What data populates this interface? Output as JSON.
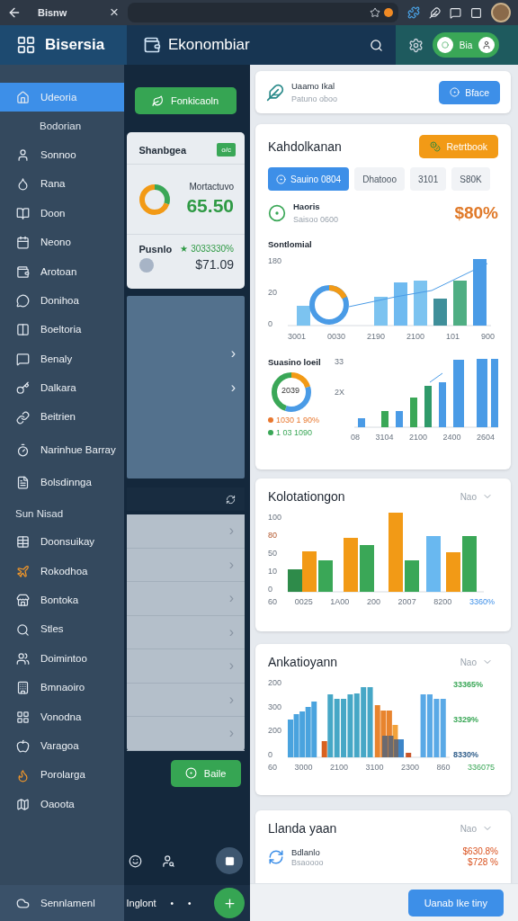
{
  "browser": {
    "tab_title": "Bisnw",
    "close": "×"
  },
  "app": {
    "brand": "Bisersia",
    "section_title": "Ekonombiar",
    "toggle": {
      "label": "Bia",
      "on": true
    }
  },
  "sidebar": {
    "items": [
      {
        "kind": "item",
        "label": "Udeoria",
        "selected": true
      },
      {
        "kind": "sub",
        "label": "Bodorian",
        "selected": false
      },
      {
        "kind": "item",
        "label": "Sonnoo",
        "selected": false
      },
      {
        "kind": "item",
        "label": "Rana",
        "selected": false
      },
      {
        "kind": "item",
        "label": "Doon",
        "selected": false
      },
      {
        "kind": "item",
        "label": "Neono",
        "selected": false
      },
      {
        "kind": "item",
        "label": "Arotoan",
        "selected": false
      },
      {
        "kind": "item",
        "label": "Donihoa",
        "selected": false
      },
      {
        "kind": "item",
        "label": "Boeltoria",
        "selected": false
      },
      {
        "kind": "item",
        "label": "Benaly",
        "selected": false
      },
      {
        "kind": "item",
        "label": "Dalkara",
        "selected": false
      },
      {
        "kind": "item",
        "label": "Beitrien",
        "selected": false
      },
      {
        "kind": "item",
        "label": "Narinhue Barray",
        "selected": false
      },
      {
        "kind": "item",
        "label": "Bolsdinnga",
        "selected": false
      },
      {
        "kind": "header",
        "label": "Sun Nisad"
      },
      {
        "kind": "item",
        "label": "Doonsuikay",
        "selected": false
      },
      {
        "kind": "item",
        "label": "Rokodhoa",
        "selected": false
      },
      {
        "kind": "item",
        "label": "Bontoka",
        "selected": false
      },
      {
        "kind": "item",
        "label": "Stles",
        "selected": false
      },
      {
        "kind": "item",
        "label": "Doimintoo",
        "selected": false
      },
      {
        "kind": "item",
        "label": "Bmnaoiro",
        "selected": false
      },
      {
        "kind": "item",
        "label": "Vonodna",
        "selected": false
      },
      {
        "kind": "item",
        "label": "Varagoa",
        "selected": false
      },
      {
        "kind": "item",
        "label": "Porolarga",
        "selected": false
      },
      {
        "kind": "item",
        "label": "Oaoota",
        "selected": false
      }
    ],
    "footer": "Sennlamenl"
  },
  "middle": {
    "primary_button": "Fonkicaoln",
    "summary": {
      "title": "Shanbgea",
      "badge": "o/c",
      "metric_label": "Mortactuvo",
      "metric_value": "65.50",
      "row_label": "Pusnlo",
      "change": "★ 3033330%",
      "amount": "$71.09"
    },
    "panel_chevrons": [
      "›",
      "›"
    ],
    "list_chevrons": [
      "›",
      "›",
      "›",
      "›",
      "›",
      "›",
      "›"
    ],
    "action_button": "Baile",
    "bottom_label": "Inglont",
    "bottom_dots": [
      "•",
      "•"
    ]
  },
  "profile": {
    "title": "Uaamo Ikal",
    "subtitle": "Patuno oboo",
    "button": "Bface"
  },
  "overview": {
    "title": "Kahdolkanan",
    "button": "Retrtbook",
    "tabs": [
      {
        "label": "Sauino 0804",
        "selected": true
      },
      {
        "label": "Dhatooo",
        "selected": false
      },
      {
        "label": "3101",
        "selected": false
      },
      {
        "label": "S80K",
        "selected": false
      }
    ],
    "stat": {
      "title": "Haoris",
      "subtitle": "Saisoo 0600",
      "value": "$80%"
    },
    "chart_1": {
      "title": "Sontlomial",
      "y_labels": [
        "180",
        "20",
        "0"
      ],
      "x_labels": [
        "3001",
        "0030",
        "2190",
        "2100",
        "101",
        "900"
      ]
    },
    "chart_2": {
      "title": "Suasino loeil",
      "donut_label": "2039",
      "legend": [
        {
          "label": "1030 1 90%",
          "color": "#e8772e"
        },
        {
          "label": "1 03 1090",
          "color": "#3aa757"
        }
      ],
      "y_labels": [
        "33",
        "2X"
      ],
      "x_labels": [
        "08",
        "3104",
        "2100",
        "2400",
        "2604"
      ]
    }
  },
  "chart_3": {
    "title": "Kolotationgon",
    "filter": "Nao",
    "y_labels": [
      "100",
      "80",
      "50",
      "10",
      "0"
    ],
    "x_labels": [
      "60",
      "0025",
      "1A00",
      "200",
      "2007",
      "8200",
      "3360%"
    ]
  },
  "chart_4": {
    "title": "Ankatioyann",
    "filter": "Nao",
    "y_labels": [
      "200",
      "300",
      "200",
      "0"
    ],
    "side_labels": [
      {
        "label": "33365%",
        "color": "#3aa757"
      },
      {
        "label": "3329%",
        "color": "#3aa757"
      },
      {
        "label": "8330%",
        "color": "#2f5d8a"
      }
    ],
    "x_labels": [
      "60",
      "3000",
      "2100",
      "3100",
      "2300",
      "860",
      "336075"
    ]
  },
  "list_card": {
    "title": "Llanda yaan",
    "filter": "Nao",
    "row_title": "Bdlanlo",
    "row_subtitle": "Bsaoooo",
    "values": [
      "$630.8%",
      "$728 %"
    ]
  },
  "footer_button": "Uanab Ike tiny"
}
